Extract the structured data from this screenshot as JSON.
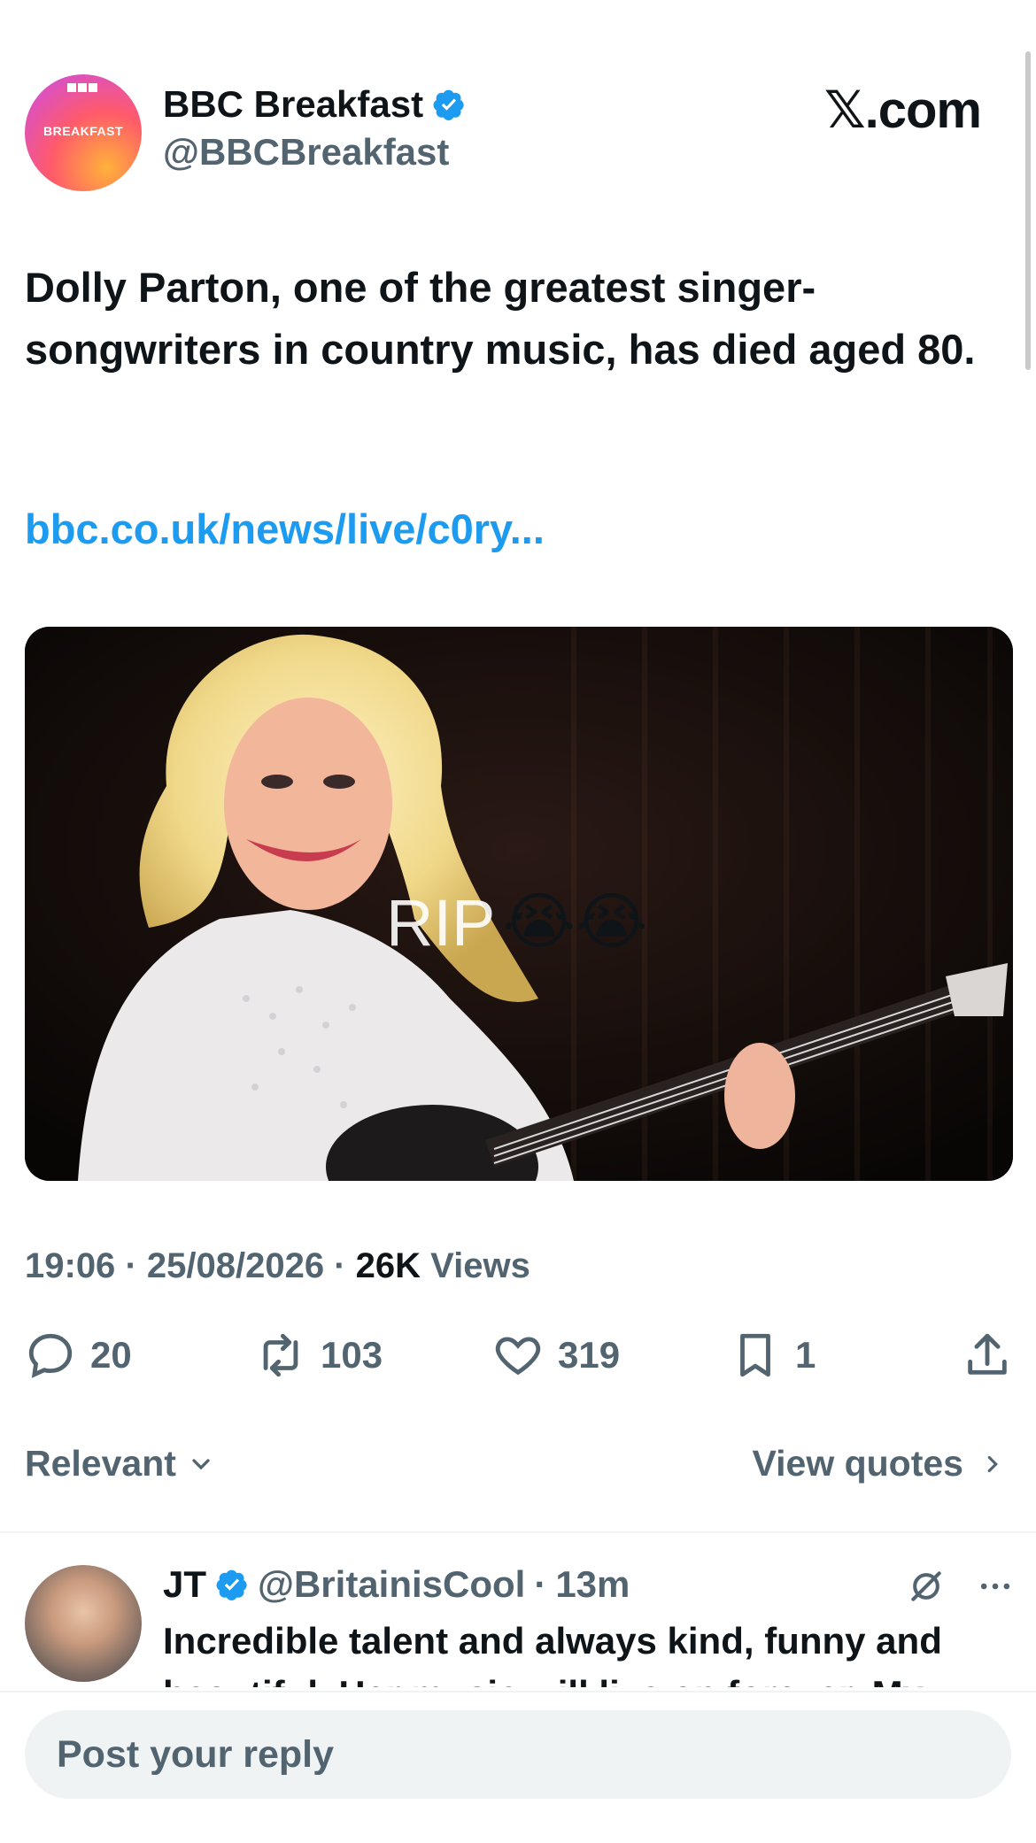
{
  "post": {
    "author_name": "BBC Breakfast",
    "author_handle": "@BBCBreakfast",
    "avatar_text": "BREAKFAST",
    "source_badge": "𝕏.com",
    "text": "Dolly Parton, one of the greatest singer-songwriters in country music, has died aged 80.",
    "link": "bbc.co.uk/news/live/c0ry...",
    "media_overlay_text": "RIP",
    "media_overlay_emoji": "😭😭",
    "time": "19:06",
    "date": "25/08/2026",
    "views_count": "26K",
    "views_label": "Views"
  },
  "actions": {
    "replies": "20",
    "reposts": "103",
    "likes": "319",
    "bookmarks": "1"
  },
  "sort": {
    "label": "Relevant",
    "view_quotes": "View quotes"
  },
  "reply": {
    "name": "JT",
    "handle": "@BritainisCool",
    "time": "13m",
    "text": "Incredible talent and always kind, funny and beautiful. Her music will live on forever. My"
  },
  "composer": {
    "placeholder": "Post your reply"
  },
  "colors": {
    "accent": "#1d9bf0",
    "secondary_text": "#536471",
    "primary_text": "#0f1419"
  }
}
